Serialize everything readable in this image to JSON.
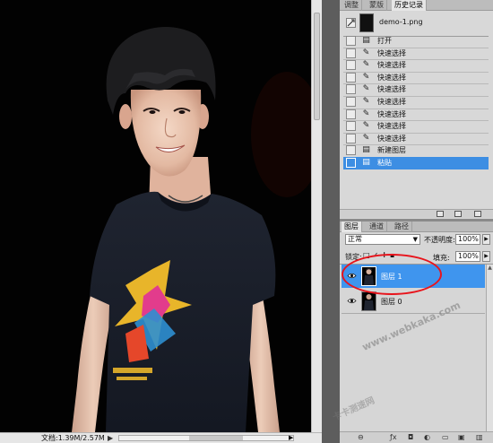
{
  "history_panel": {
    "tabs": [
      "调整",
      "蒙版",
      "历史记录"
    ],
    "active_tab": "历史记录",
    "snapshot_name": "demo-1.png",
    "items": [
      {
        "label": "打开",
        "icon": "document-icon"
      },
      {
        "label": "快速选择",
        "icon": "quick-selection-icon"
      },
      {
        "label": "快速选择",
        "icon": "quick-selection-icon"
      },
      {
        "label": "快速选择",
        "icon": "quick-selection-icon"
      },
      {
        "label": "快速选择",
        "icon": "quick-selection-icon"
      },
      {
        "label": "快速选择",
        "icon": "quick-selection-icon"
      },
      {
        "label": "快速选择",
        "icon": "quick-selection-icon"
      },
      {
        "label": "快速选择",
        "icon": "quick-selection-icon"
      },
      {
        "label": "快速选择",
        "icon": "quick-selection-icon"
      },
      {
        "label": "新建图层",
        "icon": "document-icon"
      },
      {
        "label": "粘贴",
        "icon": "document-icon",
        "selected": true
      }
    ]
  },
  "layers_panel": {
    "tabs": [
      "图层",
      "通道",
      "路径"
    ],
    "active_tab": "图层",
    "blend_mode": "正常",
    "opacity_label": "不透明度:",
    "opacity_value": "100%",
    "lock_label": "锁定:",
    "fill_label": "填充:",
    "fill_value": "100%",
    "layers": [
      {
        "name": "图层 1",
        "selected": true,
        "visible": true
      },
      {
        "name": "图层 0",
        "selected": false,
        "visible": true
      }
    ]
  },
  "status_bar": {
    "doc_info": "文档:1.39M/2.57M"
  },
  "watermark": {
    "url": "www.webkaka.com",
    "cn": "卡卡测速网"
  },
  "colors": {
    "selection": "#3d8ee3",
    "annotation": "#e8141c",
    "canvas_bg": "#020202"
  }
}
